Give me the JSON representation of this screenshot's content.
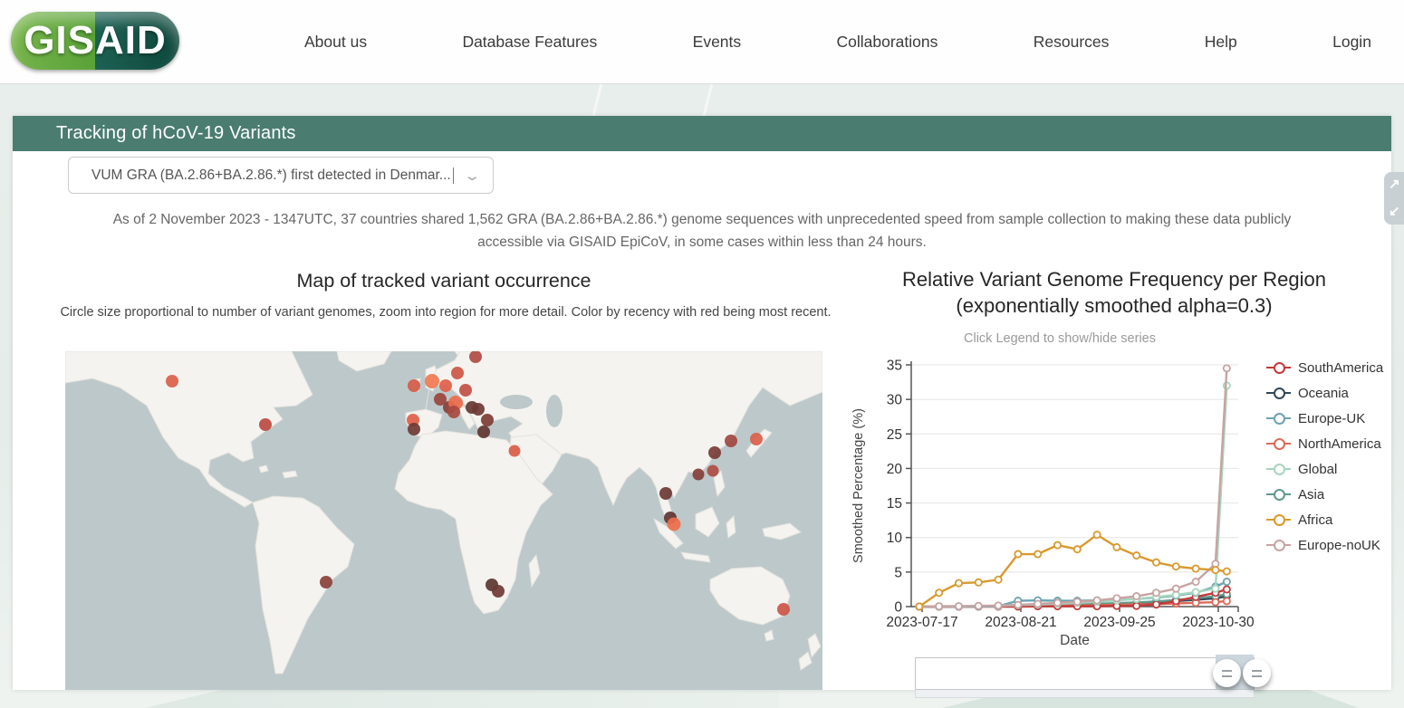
{
  "header": {
    "logo_text": "GISAID",
    "nav": [
      "About us",
      "Database Features",
      "Events",
      "Collaborations",
      "Resources",
      "Help",
      "Login"
    ]
  },
  "title_bar": {
    "title": "Tracking of hCoV-19 Variants"
  },
  "variant_select": {
    "value": "VUM GRA (BA.2.86+BA.2.86.*) first detected in Denmar...",
    "chevron_icon": "chevron-down"
  },
  "summary_text": "As of 2 November 2023 - 1347UTC, 37 countries shared 1,562 GRA (BA.2.86+BA.2.86.*) genome sequences with unprecedented speed from sample collection to making these data publicly accessible via GISAID EpiCoV, in some cases within less than 24 hours.",
  "map_section": {
    "title": "Map of tracked variant occurrence",
    "subtitle": "Circle size proportional to number of variant genomes, zoom into region for more detail. Color by recency with red being most recent.",
    "ocean_color": "#bdc8ca",
    "land_color": "#f4f3ef",
    "markers": [
      {
        "name": "canada",
        "x": 118,
        "y": 33,
        "r": 7,
        "color": "#d95f4b"
      },
      {
        "name": "us-northeast",
        "x": 221,
        "y": 81,
        "r": 7,
        "color": "#bb4b41"
      },
      {
        "name": "ireland",
        "x": 385,
        "y": 38,
        "r": 7,
        "color": "#d25a47"
      },
      {
        "name": "uk",
        "x": 405,
        "y": 33,
        "r": 8,
        "color": "#f07a50"
      },
      {
        "name": "netherlands",
        "x": 420,
        "y": 38,
        "r": 7,
        "color": "#e0604a"
      },
      {
        "name": "denmark",
        "x": 433,
        "y": 24,
        "r": 7,
        "color": "#cc5646"
      },
      {
        "name": "sweden",
        "x": 453,
        "y": 6,
        "r": 7,
        "color": "#b04c42"
      },
      {
        "name": "germany-north",
        "x": 442,
        "y": 43,
        "r": 7,
        "color": "#c05044"
      },
      {
        "name": "belgium",
        "x": 414,
        "y": 53,
        "r": 7,
        "color": "#9a453d"
      },
      {
        "name": "paris",
        "x": 424,
        "y": 62,
        "r": 7,
        "color": "#8a4038"
      },
      {
        "name": "france-east",
        "x": 431,
        "y": 57,
        "r": 8,
        "color": "#ed6b4d"
      },
      {
        "name": "switzerland",
        "x": 429,
        "y": 67,
        "r": 7,
        "color": "#a84a40"
      },
      {
        "name": "austria-1",
        "x": 449,
        "y": 62,
        "r": 7,
        "color": "#643832"
      },
      {
        "name": "austria-2",
        "x": 456,
        "y": 64,
        "r": 7,
        "color": "#6e3a34"
      },
      {
        "name": "romania",
        "x": 466,
        "y": 76,
        "r": 7,
        "color": "#7e3c36"
      },
      {
        "name": "greece",
        "x": 462,
        "y": 89,
        "r": 7,
        "color": "#5f3530"
      },
      {
        "name": "portugal-north",
        "x": 384,
        "y": 76,
        "r": 7,
        "color": "#e06049"
      },
      {
        "name": "portugal-south",
        "x": 385,
        "y": 86,
        "r": 7,
        "color": "#6e3a34"
      },
      {
        "name": "israel",
        "x": 496,
        "y": 110,
        "r": 6.5,
        "color": "#d85c48"
      },
      {
        "name": "south-korea",
        "x": 735,
        "y": 99,
        "r": 7,
        "color": "#a04840"
      },
      {
        "name": "japan",
        "x": 763,
        "y": 97,
        "r": 7,
        "color": "#d95f4b"
      },
      {
        "name": "china-east",
        "x": 717,
        "y": 112,
        "r": 7,
        "color": "#7a3c36"
      },
      {
        "name": "taiwan",
        "x": 715,
        "y": 132,
        "r": 6.5,
        "color": "#b04c42"
      },
      {
        "name": "hong-kong",
        "x": 699,
        "y": 136,
        "r": 6.5,
        "color": "#843e38"
      },
      {
        "name": "thailand",
        "x": 663,
        "y": 157,
        "r": 7,
        "color": "#6e3a34"
      },
      {
        "name": "malaysia",
        "x": 668,
        "y": 184,
        "r": 7,
        "color": "#5f3530"
      },
      {
        "name": "singapore",
        "x": 672,
        "y": 191,
        "r": 7.5,
        "color": "#ef6f4c"
      },
      {
        "name": "brazil",
        "x": 288,
        "y": 255,
        "r": 7,
        "color": "#8a4038"
      },
      {
        "name": "south-africa-1",
        "x": 471,
        "y": 258,
        "r": 7,
        "color": "#5c3630"
      },
      {
        "name": "south-africa-2",
        "x": 478,
        "y": 265,
        "r": 7,
        "color": "#6e3a34"
      },
      {
        "name": "australia",
        "x": 793,
        "y": 285,
        "r": 7,
        "color": "#cc5646"
      }
    ]
  },
  "chart_section": {
    "title_line1": "Relative Variant Genome Frequency per Region",
    "title_line2": "(exponentially smoothed alpha=0.3)",
    "subtitle": "Click Legend to show/hide series"
  },
  "chart_data": {
    "type": "line",
    "title": "Relative Variant Genome Frequency per Region (exponentially smoothed alpha=0.3)",
    "xlabel": "Date",
    "ylabel": "Smoothed Percentage (%)",
    "ylim": [
      0,
      35
    ],
    "yticks": [
      0,
      5,
      10,
      15,
      20,
      25,
      30,
      35
    ],
    "xticks": [
      "2023-07-17",
      "2023-08-21",
      "2023-09-25",
      "2023-10-30"
    ],
    "grid": true,
    "legend_position": "right",
    "x": [
      "2023-07-16",
      "2023-07-23",
      "2023-07-30",
      "2023-08-06",
      "2023-08-13",
      "2023-08-20",
      "2023-08-27",
      "2023-09-03",
      "2023-09-10",
      "2023-09-17",
      "2023-09-24",
      "2023-10-01",
      "2023-10-08",
      "2023-10-15",
      "2023-10-22",
      "2023-10-29",
      "2023-11-02"
    ],
    "series": [
      {
        "name": "SouthAmerica",
        "color": "#c23b3b",
        "values": [
          0,
          0,
          0,
          0,
          0,
          0,
          0.05,
          0.05,
          0.05,
          0.05,
          0.1,
          0.1,
          0.3,
          0.8,
          1.4,
          2.0,
          2.5
        ]
      },
      {
        "name": "Oceania",
        "color": "#31475a",
        "values": [
          0,
          0,
          0,
          0.02,
          0.05,
          0.1,
          0.15,
          0.2,
          0.25,
          0.3,
          0.4,
          0.5,
          0.6,
          0.8,
          1.0,
          1.2,
          1.5
        ]
      },
      {
        "name": "Europe-UK",
        "color": "#6ba3b0",
        "values": [
          0,
          0,
          0,
          0.02,
          0.05,
          0.85,
          0.9,
          0.85,
          0.85,
          0.9,
          0.95,
          1.1,
          1.3,
          1.6,
          2.0,
          2.9,
          3.6
        ]
      },
      {
        "name": "NorthAmerica",
        "color": "#dd6a58",
        "values": [
          0,
          0,
          0,
          0.02,
          0.05,
          0.05,
          0.1,
          0.1,
          0.15,
          0.2,
          0.25,
          0.3,
          0.35,
          0.45,
          0.55,
          0.65,
          0.8
        ]
      },
      {
        "name": "Global",
        "color": "#a5d6bf",
        "values": [
          0,
          0.05,
          0.05,
          0.1,
          0.1,
          0.2,
          0.3,
          0.4,
          0.55,
          0.7,
          0.9,
          1.1,
          1.4,
          1.7,
          2.1,
          2.6,
          32.0
        ]
      },
      {
        "name": "Asia",
        "color": "#5f998a",
        "values": [
          0,
          0,
          0.02,
          0.05,
          0.1,
          0.15,
          0.2,
          0.25,
          0.3,
          0.4,
          0.5,
          0.6,
          0.75,
          0.95,
          1.2,
          1.5,
          1.8
        ]
      },
      {
        "name": "Africa",
        "color": "#d9992e",
        "values": [
          0,
          2.0,
          3.4,
          3.5,
          3.9,
          7.6,
          7.6,
          8.9,
          8.3,
          10.4,
          8.6,
          7.4,
          6.4,
          5.8,
          5.5,
          5.3,
          5.1
        ]
      },
      {
        "name": "Europe-noUK",
        "color": "#c7a3a2",
        "values": [
          0,
          0.05,
          0.05,
          0.1,
          0.15,
          0.25,
          0.4,
          0.55,
          0.7,
          0.9,
          1.2,
          1.5,
          2.0,
          2.6,
          3.6,
          6.2,
          34.5
        ]
      }
    ],
    "draw_order": [
      "Oceania",
      "Asia",
      "NorthAmerica",
      "SouthAmerica",
      "Europe-UK",
      "Global",
      "Europe-noUK",
      "Africa"
    ]
  },
  "date_slider": {
    "handle_icon": "drag-lines",
    "selected_region_color": "#ccd6dd"
  },
  "edge_widget": {
    "icon": "resize-diagonal-arrows",
    "arrow_up": "↗",
    "arrow_down": "↙"
  }
}
